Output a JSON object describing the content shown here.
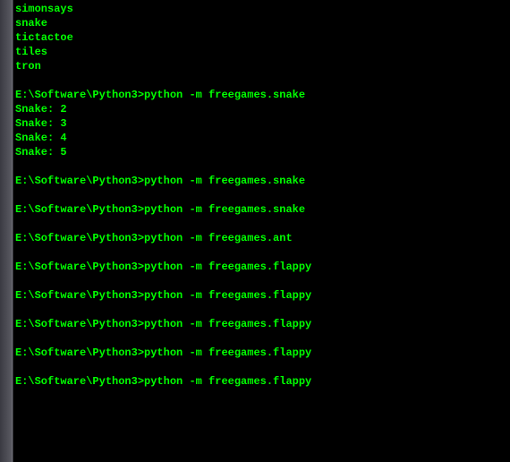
{
  "prompt": "E:\\Software\\Python3>",
  "listing": [
    "simonsays",
    "snake",
    "tictactoe",
    "tiles",
    "tron"
  ],
  "sessions": [
    {
      "command": "python -m freegames.snake",
      "output": [
        "Snake: 2",
        "Snake: 3",
        "Snake: 4",
        "Snake: 5"
      ]
    },
    {
      "command": "python -m freegames.snake",
      "output": []
    },
    {
      "command": "python -m freegames.snake",
      "output": []
    },
    {
      "command": "python -m freegames.ant",
      "output": []
    },
    {
      "command": "python -m freegames.flappy",
      "output": []
    },
    {
      "command": "python -m freegames.flappy",
      "output": []
    },
    {
      "command": "python -m freegames.flappy",
      "output": []
    },
    {
      "command": "python -m freegames.flappy",
      "output": []
    },
    {
      "command": "python -m freegames.flappy",
      "output": []
    }
  ]
}
